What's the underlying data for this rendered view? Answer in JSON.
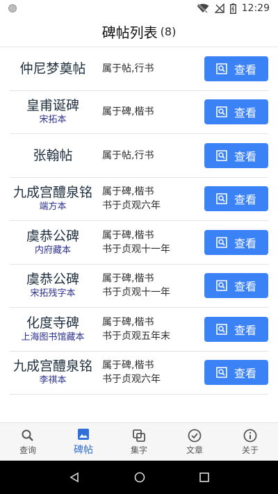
{
  "status": {
    "time": "12:29"
  },
  "header": {
    "title": "碑帖列表",
    "count": "(8)"
  },
  "items": [
    {
      "name": "仲尼梦奠帖",
      "edition": "",
      "info1": "属于帖,行书",
      "info2": "",
      "button": "查看"
    },
    {
      "name": "皇甫诞碑",
      "edition": "宋拓本",
      "info1": "属于碑,楷书",
      "info2": "",
      "button": "查看"
    },
    {
      "name": "张翰帖",
      "edition": "",
      "info1": "属于帖,行书",
      "info2": "",
      "button": "查看"
    },
    {
      "name": "九成宫醴泉铭",
      "edition": "端方本",
      "info1": "属于碑,楷书",
      "info2": "书于贞观六年",
      "button": "查看"
    },
    {
      "name": "虞恭公碑",
      "edition": "内府藏本",
      "info1": "属于碑,楷书",
      "info2": "书于贞观十一年",
      "button": "查看"
    },
    {
      "name": "虞恭公碑",
      "edition": "宋拓残字本",
      "info1": "属于碑,楷书",
      "info2": "书于贞观十一年",
      "button": "查看"
    },
    {
      "name": "化度寺碑",
      "edition": "上海图书馆藏本",
      "info1": "属于碑,楷书",
      "info2": "书于贞观五年末",
      "button": "查看"
    },
    {
      "name": "九成宫醴泉铭",
      "edition": "李祺本",
      "info1": "属于碑,楷书",
      "info2": "书于贞观六年",
      "button": "查看"
    }
  ],
  "nav": {
    "query": "查询",
    "stele": "碑帖",
    "collect": "集字",
    "article": "文章",
    "about": "关于"
  },
  "colors": {
    "accent": "#3b82f6",
    "nav_active": "#2f6fd6",
    "edition": "#2b2f8f"
  }
}
